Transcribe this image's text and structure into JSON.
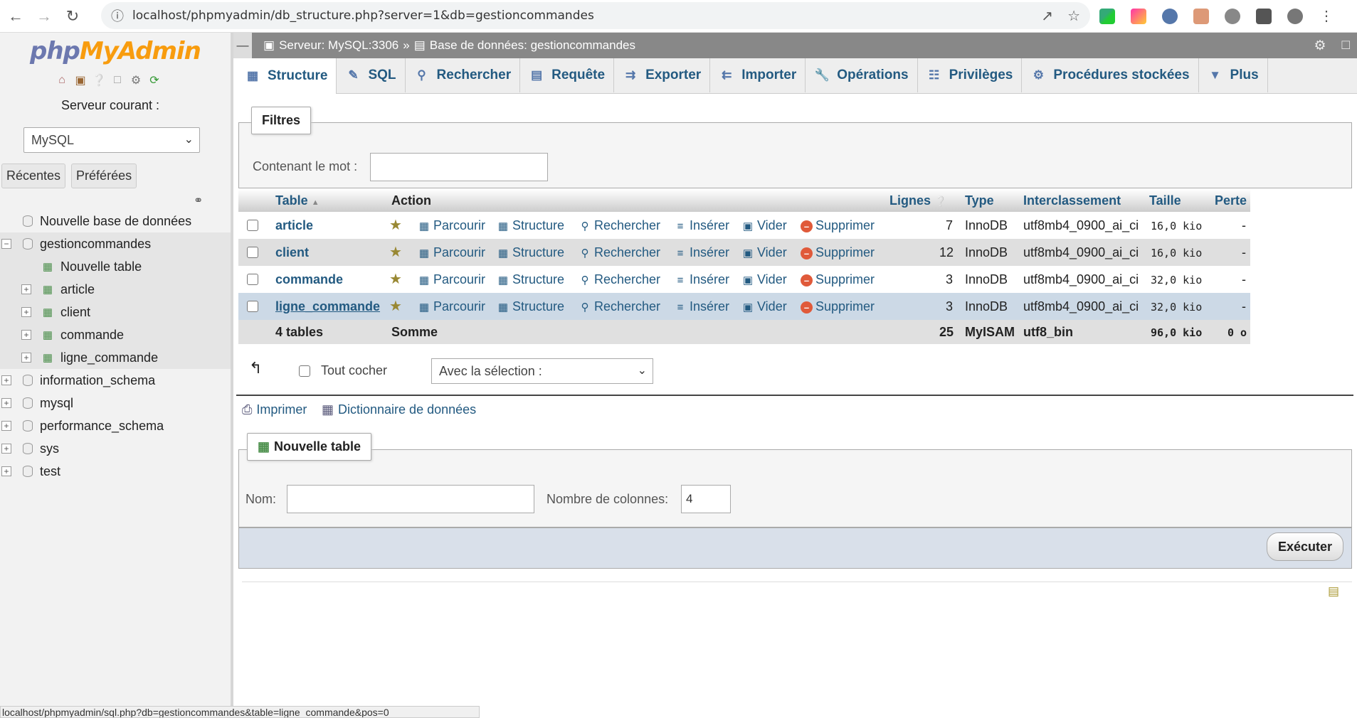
{
  "browser": {
    "url": "localhost/phpmyadmin/db_structure.php?server=1&db=gestioncommandes",
    "status_url": "localhost/phpmyadmin/sql.php?db=gestioncommandes&table=ligne_commande&pos=0"
  },
  "nav": {
    "logo_php": "php",
    "logo_my": "MyAdmin",
    "server_label": "Serveur courant :",
    "server_value": "MySQL",
    "tab_recent": "Récentes",
    "tab_fav": "Préférées",
    "new_db": "Nouvelle base de données",
    "db_current": "gestioncommandes",
    "new_table": "Nouvelle table",
    "tables": [
      "article",
      "client",
      "commande",
      "ligne_commande"
    ],
    "other_dbs": [
      "information_schema",
      "mysql",
      "performance_schema",
      "sys",
      "test"
    ]
  },
  "breadcrumb": {
    "server": "Serveur: MySQL:3306",
    "sep": "»",
    "db": "Base de données: gestioncommandes"
  },
  "tabs": [
    "Structure",
    "SQL",
    "Rechercher",
    "Requête",
    "Exporter",
    "Importer",
    "Opérations",
    "Privilèges",
    "Procédures stockées",
    "Plus"
  ],
  "filters": {
    "legend": "Filtres",
    "label": "Contenant le mot :"
  },
  "table": {
    "headers": {
      "table": "Table",
      "action": "Action",
      "rows": "Lignes",
      "type": "Type",
      "collation": "Interclassement",
      "size": "Taille",
      "overhead": "Perte"
    },
    "actions": {
      "browse": "Parcourir",
      "structure": "Structure",
      "search": "Rechercher",
      "insert": "Insérer",
      "empty": "Vider",
      "drop": "Supprimer"
    },
    "rows": [
      {
        "name": "article",
        "rows": "7",
        "type": "InnoDB",
        "collation": "utf8mb4_0900_ai_ci",
        "size": "16,0 kio",
        "overhead": "-"
      },
      {
        "name": "client",
        "rows": "12",
        "type": "InnoDB",
        "collation": "utf8mb4_0900_ai_ci",
        "size": "16,0 kio",
        "overhead": "-"
      },
      {
        "name": "commande",
        "rows": "3",
        "type": "InnoDB",
        "collation": "utf8mb4_0900_ai_ci",
        "size": "32,0 kio",
        "overhead": "-"
      },
      {
        "name": "ligne_commande",
        "rows": "3",
        "type": "InnoDB",
        "collation": "utf8mb4_0900_ai_ci",
        "size": "32,0 kio",
        "overhead": "-"
      }
    ],
    "footer": {
      "count": "4 tables",
      "sum_label": "Somme",
      "rows": "25",
      "type": "MyISAM",
      "collation": "utf8_bin",
      "size": "96,0 kio",
      "overhead": "0 o"
    }
  },
  "bulk": {
    "check_all": "Tout cocher",
    "with_selected": "Avec la sélection :"
  },
  "links": {
    "print": "Imprimer",
    "dictionary": "Dictionnaire de données"
  },
  "create": {
    "legend": "Nouvelle table",
    "name_label": "Nom:",
    "cols_label": "Nombre de colonnes:",
    "cols_value": "4",
    "submit": "Exécuter"
  },
  "colors": {
    "link": "#235a81",
    "topbar": "#888888",
    "hover_row": "#ccd9e6"
  }
}
